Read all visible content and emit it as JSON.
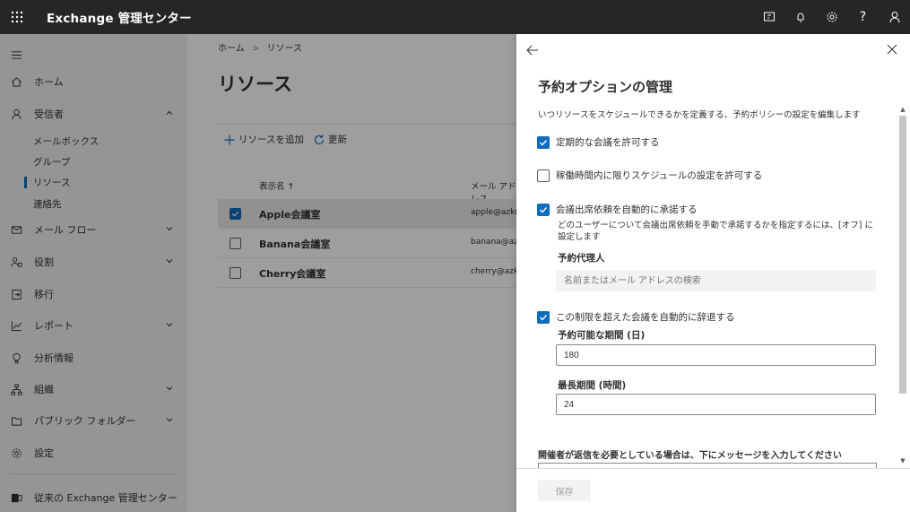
{
  "topbar": {
    "title": "Exchange 管理センター",
    "icons": [
      "screen-share-icon",
      "bell-icon",
      "gear-icon",
      "help-icon",
      "person-icon"
    ],
    "help_glyph": "?"
  },
  "nav": {
    "items": [
      {
        "label": "ホーム",
        "icon": "home-icon"
      },
      {
        "label": "受信者",
        "icon": "person-icon",
        "expanded": true
      },
      {
        "label": "メール フロー",
        "icon": "mail-icon"
      },
      {
        "label": "役割",
        "icon": "roles-icon"
      },
      {
        "label": "移行",
        "icon": "migration-icon"
      },
      {
        "label": "レポート",
        "icon": "report-icon"
      },
      {
        "label": "分析情報",
        "icon": "lightbulb-icon"
      },
      {
        "label": "組織",
        "icon": "org-icon"
      },
      {
        "label": "パブリック フォルダー",
        "icon": "folder-icon"
      },
      {
        "label": "設定",
        "icon": "gear-icon"
      }
    ],
    "subitems": [
      "メールボックス",
      "グループ",
      "リソース",
      "連絡先"
    ],
    "classic_link": "従来の Exchange 管理センター"
  },
  "main": {
    "breadcrumb": {
      "home": "ホーム",
      "sep": ">",
      "current": "リソース"
    },
    "title": "リソース",
    "toolbar": {
      "add": "リソースを追加",
      "refresh": "更新"
    },
    "columns": {
      "name": "表示名 ↑",
      "email": "メール アドレス"
    },
    "rows": [
      {
        "name": "Apple会議室",
        "email": "apple@azkm",
        "checked": true
      },
      {
        "name": "Banana会議室",
        "email": "banana@azk",
        "checked": false
      },
      {
        "name": "Cherry会議室",
        "email": "cherry@azkm",
        "checked": false
      }
    ]
  },
  "panel": {
    "title": "予約オプションの管理",
    "description": "いつリソースをスケジュールできるかを定義する、予約ポリシーの設定を編集します",
    "opt1": "定期的な会議を許可する",
    "opt2": "稼働時間内に限りスケジュールの設定を許可する",
    "opt3": "会議出席依頼を自動的に承諾する",
    "opt3_help": "どのユーザーについて会議出席依頼を手動で承諾するかを指定するには、[オフ] に設定します",
    "delegate_label": "予約代理人",
    "delegate_placeholder": "名前またはメール アドレスの検索",
    "opt4": "この制限を超えた会議を自動的に辞退する",
    "window_label": "予約可能な期間 (日)",
    "window_value": "180",
    "duration_label": "最長期間 (時間)",
    "duration_value": "24",
    "organizer_msg": "開催者が返信を必要としている場合は、下にメッセージを入力してください",
    "save": "保存"
  },
  "colors": {
    "accent": "#0f6cbd",
    "topbar": "#262626"
  }
}
